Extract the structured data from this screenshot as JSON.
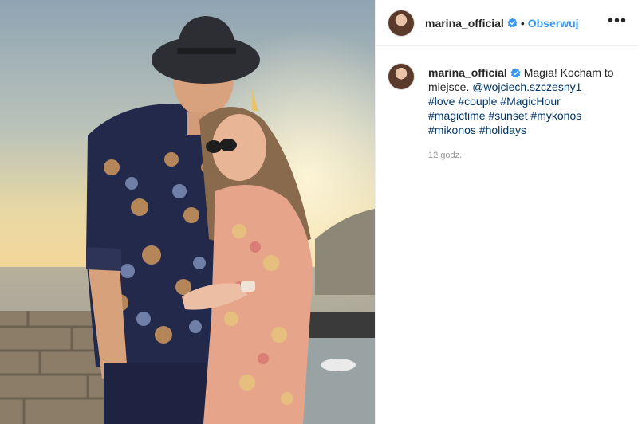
{
  "header": {
    "username": "marina_official",
    "separator": "•",
    "follow_label": "Obserwuj",
    "more_label": "•••"
  },
  "caption": {
    "username": "marina_official",
    "text": "Magia! Kocham to miejsce.",
    "mention": "@wojciech.szczesny1",
    "hashtags": [
      "#love",
      "#couple",
      "#MagicHour",
      "#magictime",
      "#sunset",
      "#mykonos",
      "#mikonos",
      "#holidays"
    ],
    "time": "12 godz."
  },
  "icons": {
    "verified": "verified-badge-icon",
    "more": "more-options-icon"
  },
  "colors": {
    "link": "#3897f0",
    "hashtag": "#003569",
    "muted": "#999999",
    "verified": "#3897f0"
  }
}
